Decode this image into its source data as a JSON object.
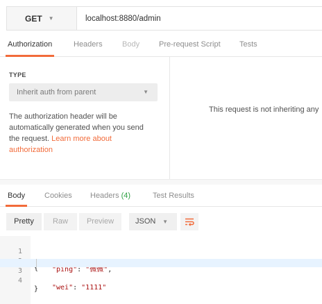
{
  "request": {
    "method": "GET",
    "url": "localhost:8880/admin"
  },
  "request_tabs": {
    "authorization": "Authorization",
    "headers": "Headers",
    "body": "Body",
    "prerequest": "Pre-request Script",
    "tests": "Tests"
  },
  "auth": {
    "type_label": "TYPE",
    "type_value": "Inherit auth from parent",
    "desc_line1": "The authorization header will be",
    "desc_line2": "automatically generated when you send",
    "desc_line3_prefix": "the request. ",
    "desc_link_part1": "Learn more about",
    "desc_link_part2": "authorization",
    "right_message": "This request is not inheriting any"
  },
  "response_tabs": {
    "body": "Body",
    "cookies": "Cookies",
    "headers": "Headers",
    "headers_count": "(4)",
    "test_results": "Test Results"
  },
  "format": {
    "pretty": "Pretty",
    "raw": "Raw",
    "preview": "Preview",
    "json": "JSON"
  },
  "editor": {
    "lines": [
      {
        "num": "1",
        "fold": "▾",
        "text": "{"
      },
      {
        "num": "2",
        "key": "\"ping\"",
        "sep": ": ",
        "val": "\"微微\"",
        "end": ","
      },
      {
        "num": "3",
        "key": "\"wei\"",
        "sep": ": ",
        "val": "\"1111\"",
        "end": ""
      },
      {
        "num": "4",
        "text": "}"
      }
    ]
  },
  "colors": {
    "accent": "#f26b3a",
    "count": "#2ea043",
    "highlight_line": "#e7f3ff"
  },
  "icons": {
    "method_caret": "chevron-down-icon",
    "wrap": "wrap-lines-icon"
  }
}
